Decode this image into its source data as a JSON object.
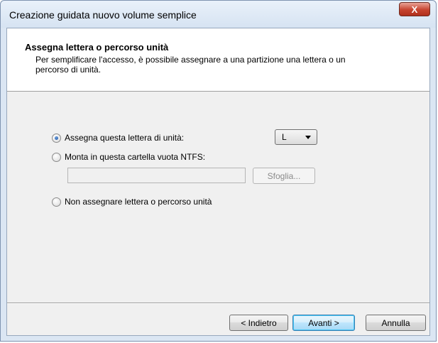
{
  "window": {
    "title": "Creazione guidata nuovo volume semplice",
    "close_label": "X"
  },
  "header": {
    "title": "Assegna lettera o percorso unità",
    "description": "Per semplificare l'accesso, è possibile assegnare a una partizione una lettera o un percorso di unità."
  },
  "options": {
    "assign_letter": {
      "label": "Assegna questa lettera di unità:",
      "selected": true
    },
    "mount_folder": {
      "label": "Monta in questa cartella vuota NTFS:",
      "selected": false
    },
    "no_assign": {
      "label": "Non assegnare lettera o percorso unità",
      "selected": false
    }
  },
  "drive_letter": {
    "value": "L"
  },
  "folder_path": {
    "value": ""
  },
  "browse_button": {
    "label": "Sfoglia..."
  },
  "footer": {
    "back_label": "< Indietro",
    "next_label": "Avanti >",
    "cancel_label": "Annulla"
  }
}
